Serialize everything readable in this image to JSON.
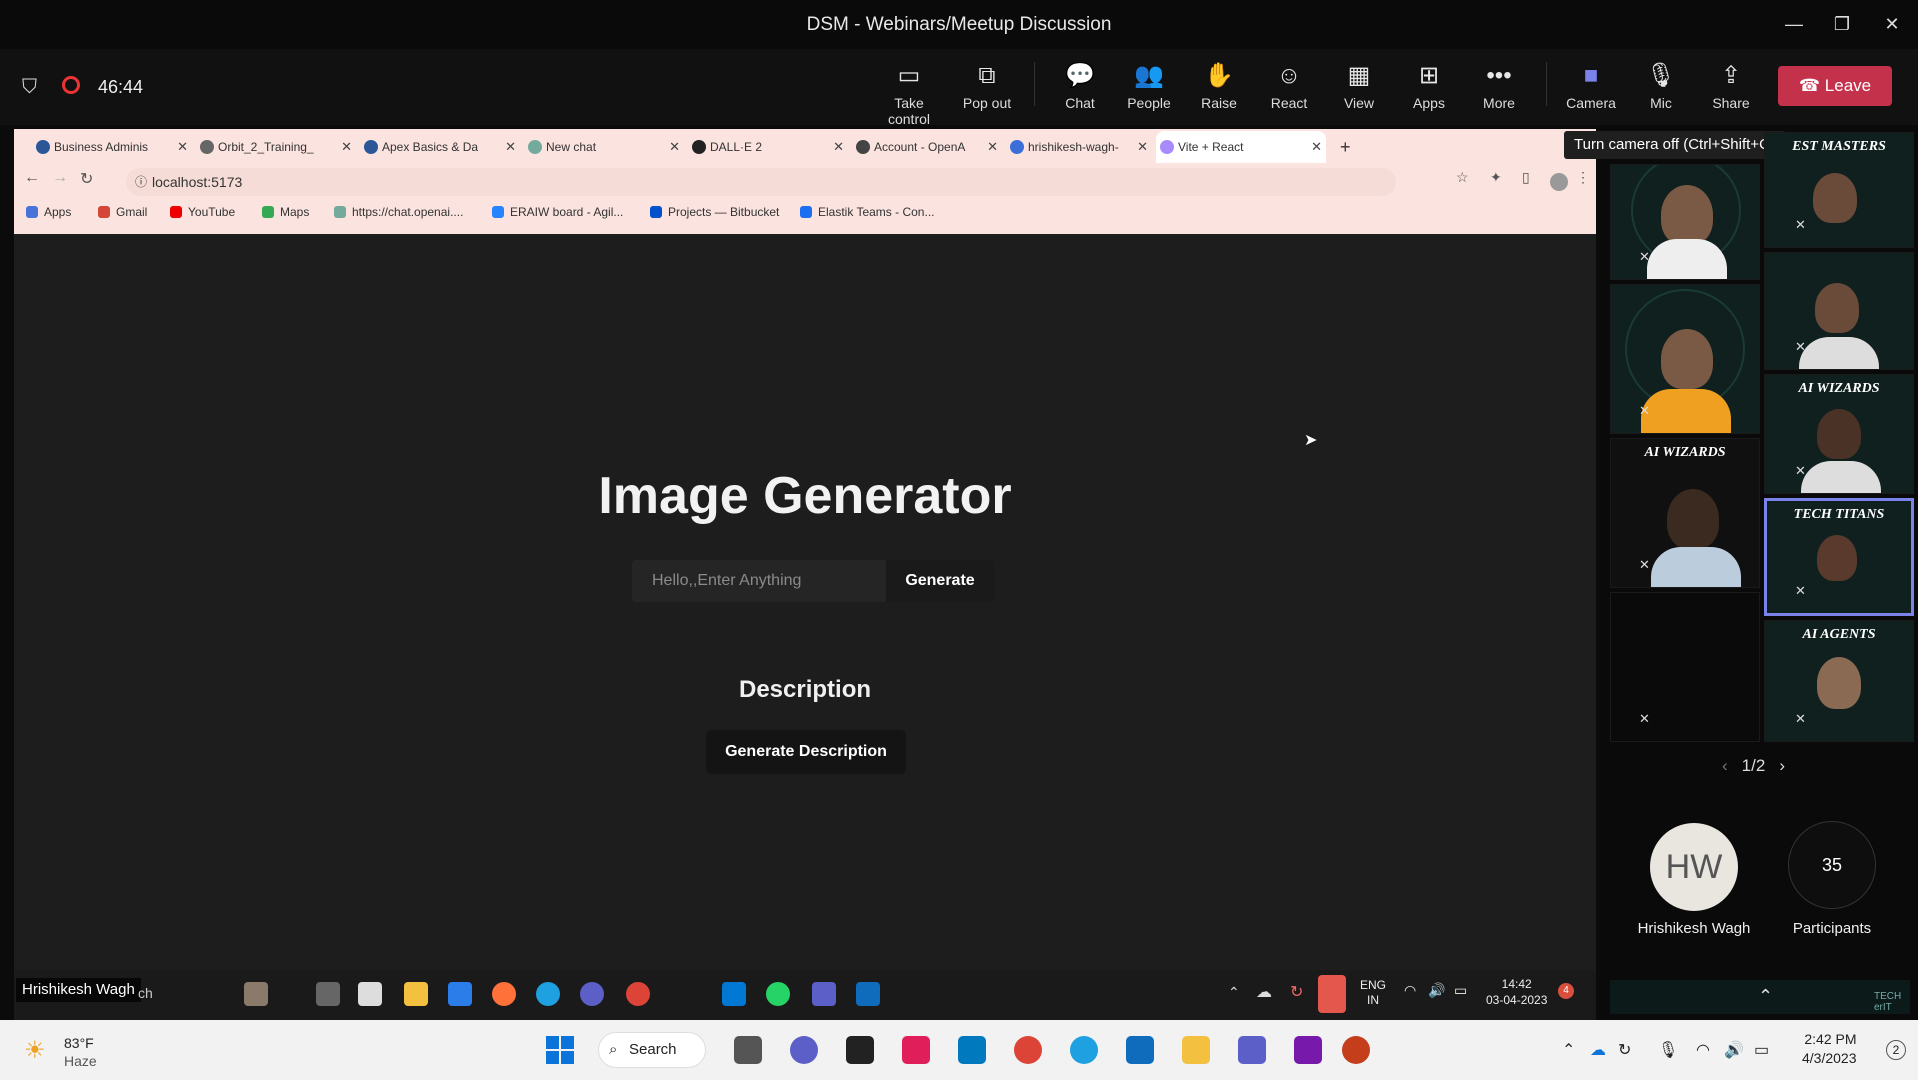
{
  "window": {
    "title": "DSM - Webinars/Meetup Discussion",
    "min": "—",
    "max": "❐",
    "close": "✕"
  },
  "meeting": {
    "timer": "46:44",
    "tools": [
      "Take control",
      "Pop out",
      "Chat",
      "People",
      "Raise",
      "React",
      "View",
      "Apps",
      "More",
      "Camera",
      "Mic",
      "Share"
    ],
    "leave": "Leave",
    "tooltip": "Turn camera off (Ctrl+Shift+O)"
  },
  "browser": {
    "tabs": [
      "Business Adminis",
      "Orbit_2_Training_",
      "Apex Basics & Da",
      "New chat",
      "DALL·E 2",
      "Account - OpenA",
      "hrishikesh-wagh-",
      "Vite + React"
    ],
    "new_tab": "+",
    "url": "localhost:5173",
    "bookmarks": [
      "Apps",
      "Gmail",
      "YouTube",
      "Maps",
      "https://chat.openai....",
      "ERAIW board - Agil...",
      "Projects — Bitbucket",
      "Elastik Teams - Con..."
    ]
  },
  "app": {
    "heading": "Image Generator",
    "prompt_placeholder": "Hello,,Enter Anything",
    "generate": "Generate",
    "description_heading": "Description",
    "generate_description": "Generate Description"
  },
  "shared_taskbar": {
    "presenter": "Hrishikesh Wagh",
    "search_hint": "ch",
    "lang": "ENG",
    "region": "IN",
    "time": "14:42",
    "date": "03-04-2023",
    "notif": "4"
  },
  "participants": {
    "tiles": [
      "EST MASTERS",
      "AI WIZARDS",
      "AI WIZARDS",
      "TECH TITANS",
      "AI AGENTS"
    ],
    "page": "1/2",
    "user_initials": "HW",
    "user_name": "Hrishikesh Wagh",
    "count": "35",
    "count_label": "Participants",
    "bottom_tag": "TECH erIT"
  },
  "windows": {
    "weather_temp": "83°F",
    "weather_desc": "Haze",
    "search": "Search",
    "time": "2:42 PM",
    "date": "4/3/2023",
    "notif": "2"
  }
}
